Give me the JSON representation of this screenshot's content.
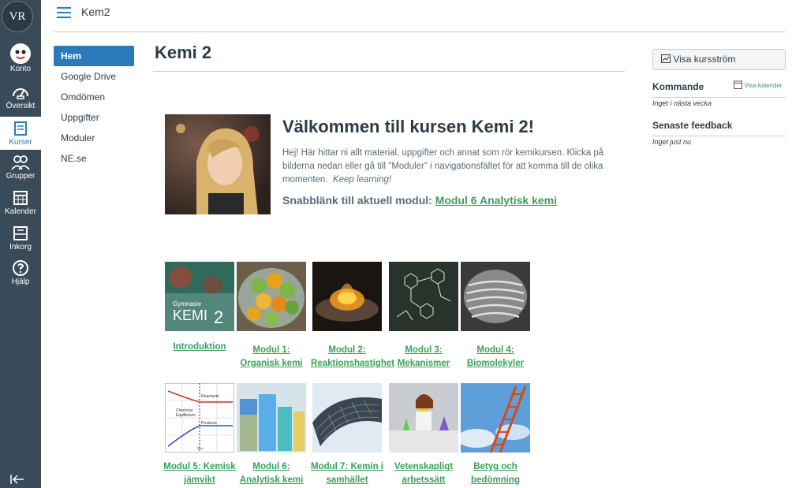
{
  "global_nav": {
    "logo": "VR",
    "items": [
      {
        "label": "Konto",
        "icon": "avatar"
      },
      {
        "label": "Översikt",
        "icon": "dashboard-icon"
      },
      {
        "label": "Kurser",
        "icon": "courses-icon"
      },
      {
        "label": "Grupper",
        "icon": "groups-icon"
      },
      {
        "label": "Kalender",
        "icon": "calendar-icon"
      },
      {
        "label": "Inkorg",
        "icon": "inbox-icon"
      },
      {
        "label": "Hjälp",
        "icon": "help-icon"
      }
    ],
    "active": "Kurser"
  },
  "header": {
    "breadcrumb": "Kem2"
  },
  "course_nav": {
    "items": [
      "Hem",
      "Google Drive",
      "Omdömen",
      "Uppgifter",
      "Moduler",
      "NE.se"
    ],
    "active": "Hem"
  },
  "page": {
    "title": "Kemi 2",
    "welcome": "Välkommen till kursen Kemi 2!",
    "intro": "Hej! Här hittar ni allt material, uppgifter och annat som rör kemikursen. Klicka på bilderna nedan eller gå till \"Moduler\" i navigationsfältet för att komma till de olika momenten.",
    "intro_em": "Keep learning!",
    "quick_label": "Snabblänk till aktuell modul:",
    "quick_link": "Modul 6 Analytisk kemi"
  },
  "modules": [
    {
      "line1": "Introduktion",
      "line2": ""
    },
    {
      "line1": "Modul 1:",
      "line2": "Organisk kemi"
    },
    {
      "line1": "Modul 2:",
      "line2": "Reaktionshastighet"
    },
    {
      "line1": "Modul 3:",
      "line2": "Mekanismer"
    },
    {
      "line1": "Modul 4:",
      "line2": "Biomolekyler"
    },
    {
      "line1": "Modul 5: Kemisk",
      "line2": "jämvikt"
    },
    {
      "line1": "Modul 6:",
      "line2": "Analytisk kemi"
    },
    {
      "line1": "Modul 7: Kemin i",
      "line2": "samhället"
    },
    {
      "line1": "Vetenskapligt",
      "line2": "arbetssätt"
    },
    {
      "line1": "Betyg och",
      "line2": "bedömning"
    }
  ],
  "thumb_text": {
    "intro_book_small": "Gymnasie",
    "intro_book_big": "KEMI",
    "intro_book_num": "2",
    "eq_reactants": "Reactants",
    "eq_chem": "Chemical",
    "eq_equil": "Equilibrium",
    "eq_products": "Products",
    "eq_time": "Time"
  },
  "sidebar": {
    "stream_button": "Visa kursström",
    "upcoming_title": "Kommande",
    "calendar_link": "Visa kalender",
    "upcoming_empty": "Inget i nästa vecka",
    "feedback_title": "Senaste feedback",
    "feedback_empty": "Inget just nu"
  },
  "colors": {
    "nav_bg": "#394b58",
    "accent": "#2b7abc",
    "link": "#3aa05a"
  }
}
